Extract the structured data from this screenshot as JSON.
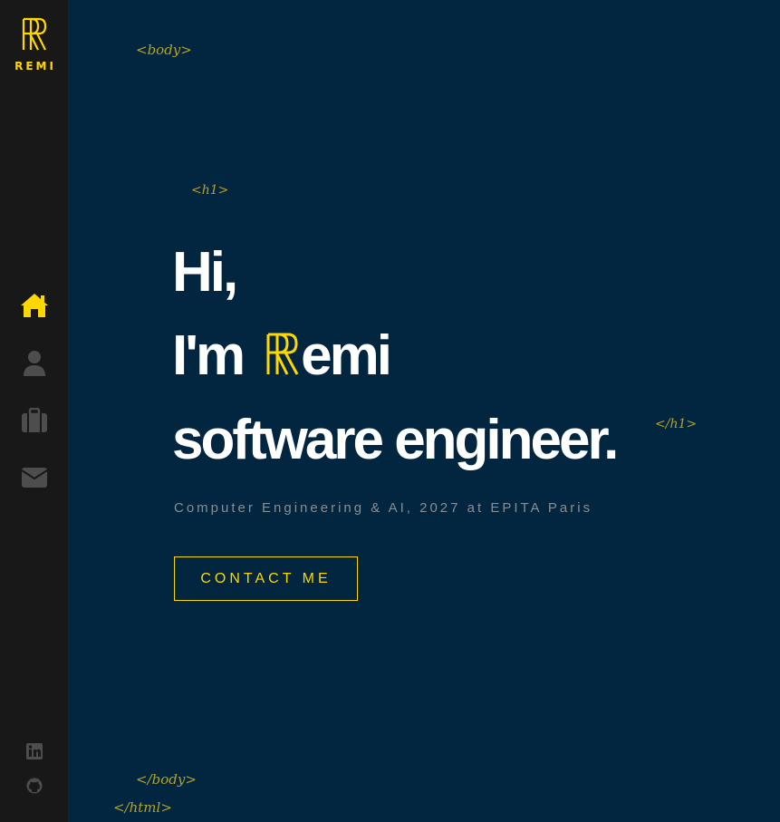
{
  "sidebar": {
    "logo_text": "REMI",
    "nav": [
      {
        "name": "home",
        "icon": "home-icon",
        "active": true
      },
      {
        "name": "about",
        "icon": "user-icon",
        "active": false
      },
      {
        "name": "portfolio",
        "icon": "briefcase-icon",
        "active": false
      },
      {
        "name": "contact",
        "icon": "envelope-icon",
        "active": false
      }
    ],
    "social": [
      {
        "name": "linkedin",
        "icon": "linkedin-icon"
      },
      {
        "name": "github",
        "icon": "github-icon"
      }
    ]
  },
  "tags": {
    "body_open": "<body>",
    "h1_open": "<h1>",
    "h1_close": "</h1>",
    "body_close": "</body>",
    "html_close": "</html>"
  },
  "hero": {
    "line1": "Hi,",
    "line2_prefix": "I'm",
    "line2_suffix": "emi",
    "line3": "software engineer."
  },
  "subtitle": "Computer Engineering & AI, 2027 at EPITA Paris",
  "cta": {
    "label": "CONTACT ME"
  },
  "colors": {
    "accent": "#ffd700",
    "background": "#022640",
    "sidebar": "#181818",
    "tag": "#b5a22a",
    "icon_inactive": "#4d4d4e"
  }
}
